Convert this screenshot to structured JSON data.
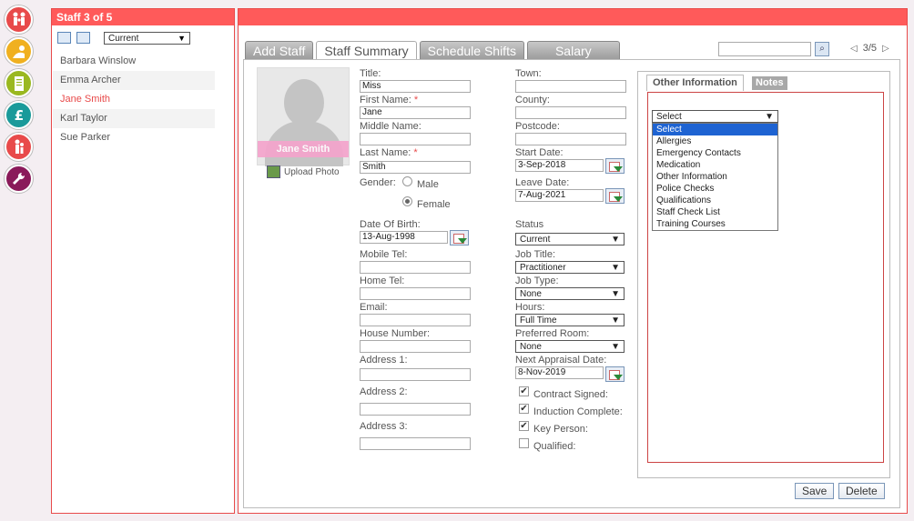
{
  "rail": [
    {
      "name": "family-icon",
      "color": "#e84a4a"
    },
    {
      "name": "child-icon",
      "color": "#f0b020"
    },
    {
      "name": "notes-icon",
      "color": "#9ab820"
    },
    {
      "name": "pound-icon",
      "color": "#1a9a9a"
    },
    {
      "name": "staff-icon",
      "color": "#e84a4a"
    },
    {
      "name": "wrench-icon",
      "color": "#8a1a5a"
    }
  ],
  "staff_panel": {
    "title": "Staff 3 of 5",
    "filter": "Current",
    "staff": [
      "Barbara Winslow",
      "Emma Archer",
      "Jane Smith",
      "Karl Taylor",
      "Sue Parker"
    ],
    "selected": "Jane Smith"
  },
  "tabs": [
    "Add Staff",
    "Staff Summary",
    "Schedule Shifts",
    "Salary"
  ],
  "active_tab": "Staff Summary",
  "search": {
    "value": ""
  },
  "pager": "3/5",
  "photo": {
    "name": "Jane Smith",
    "upload_label": "Upload Photo"
  },
  "form": {
    "title_label": "Title:",
    "title_value": "Miss",
    "first_label": "First Name:",
    "first_value": "Jane",
    "middle_label": "Middle Name:",
    "middle_value": "",
    "last_label": "Last Name:",
    "last_value": "Smith",
    "gender_label": "Gender:",
    "male": "Male",
    "female": "Female",
    "gender_value": "Female",
    "dob_label": "Date Of Birth:",
    "dob_value": "13-Aug-1998",
    "mobile_label": "Mobile Tel:",
    "home_label": "Home Tel:",
    "email_label": "Email:",
    "house_label": "House Number:",
    "addr1_label": "Address 1:",
    "addr2_label": "Address 2:",
    "addr3_label": "Address 3:",
    "town_label": "Town:",
    "county_label": "County:",
    "postcode_label": "Postcode:",
    "start_label": "Start Date:",
    "start_value": "3-Sep-2018",
    "leave_label": "Leave Date:",
    "leave_value": "7-Aug-2021",
    "status_label": "Status",
    "status_value": "Current",
    "job_title_label": "Job Title:",
    "job_title_value": "Practitioner",
    "job_type_label": "Job Type:",
    "job_type_value": "None",
    "hours_label": "Hours:",
    "hours_value": "Full Time",
    "room_label": "Preferred Room:",
    "room_value": "None",
    "appraisal_label": "Next Appraisal Date:",
    "appraisal_value": "8-Nov-2019",
    "contract_label": "Contract Signed:",
    "induction_label": "Induction Complete:",
    "key_label": "Key Person:",
    "qualified_label": "Qualified:"
  },
  "checks": {
    "contract": true,
    "induction": true,
    "key": true,
    "qualified": false
  },
  "right": {
    "tab_active": "Other Information",
    "tab_other": "Notes",
    "dropdown_value": "Select",
    "options": [
      "Select",
      "Allergies",
      "Emergency Contacts",
      "Medication",
      "Other Information",
      "Police Checks",
      "Qualifications",
      "Staff Check List",
      "Training Courses"
    ],
    "save": "Save",
    "delete": "Delete"
  }
}
